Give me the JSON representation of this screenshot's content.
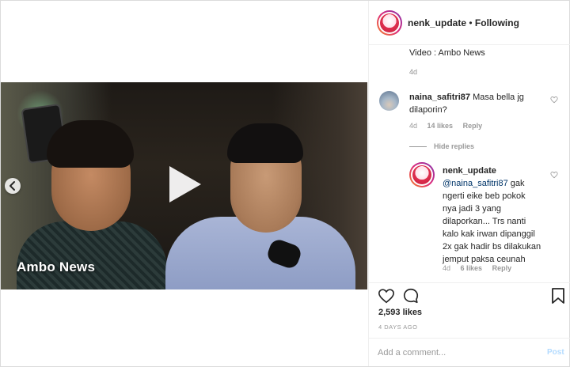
{
  "post": {
    "username": "nenk_update",
    "separator": "•",
    "follow_label": "Following"
  },
  "media": {
    "watermark": "Ambo News",
    "play_icon": "play-icon",
    "prev_icon": "chevron-left-icon"
  },
  "caption": {
    "text": "Video : Ambo News",
    "time": "4d"
  },
  "comments": [
    {
      "user": "naina_safitri87",
      "text": "Masa bella jg dilaporin?",
      "time": "4d",
      "likes": "14 likes",
      "reply_label": "Reply"
    }
  ],
  "hide_replies_label": "Hide replies",
  "reply": {
    "user": "nenk_update",
    "mention": "@naina_safitri87",
    "lines": [
      "gak",
      "ngerti eike beb pokok",
      "nya jadi 3 yang",
      "dilaporkan... Trs nanti",
      "kalo kak irwan dipanggil",
      "2x gak hadir bs dilakukan",
      "jemput paksa ceunah"
    ],
    "time": "4d",
    "likes": "6 likes",
    "reply_label": "Reply"
  },
  "actions": {
    "likes": "2,593 likes",
    "date": "4 DAYS AGO"
  },
  "add_comment": {
    "placeholder": "Add a comment...",
    "post_label": "Post"
  }
}
